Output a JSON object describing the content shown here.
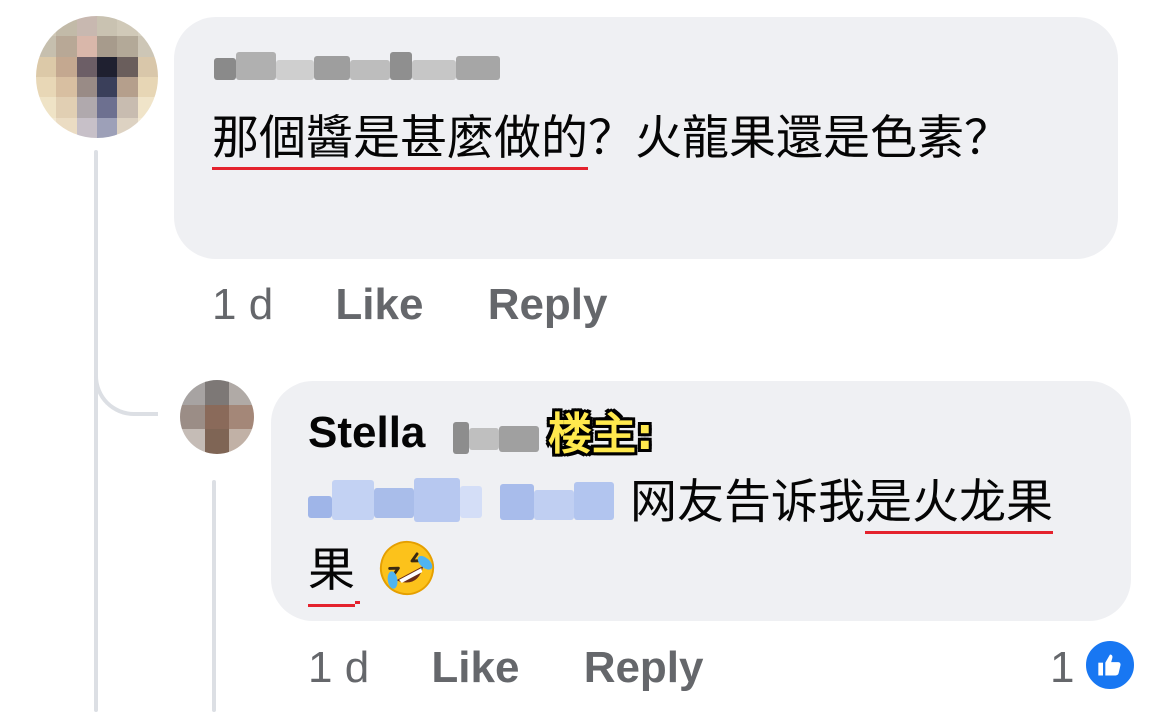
{
  "comments": [
    {
      "author_redacted": true,
      "text_part1": "那個醬是甚麼做的",
      "text_part2": "？火龍果還是色素？",
      "time": "1 d",
      "like_label": "Like",
      "reply_label": "Reply"
    },
    {
      "author_first": "Stella",
      "op_badge": "楼主:",
      "mention_redacted": true,
      "text_part1": "网友告诉我",
      "text_part2": "是火龙果",
      "emoji": "rolling-on-floor-laughing",
      "time": "1 d",
      "like_label": "Like",
      "reply_label": "Reply",
      "reaction_count": "1"
    }
  ],
  "colors": {
    "bubble": "#eff0f3",
    "underline": "#e4222d",
    "meta": "#65676b",
    "like_blue": "#1877f2",
    "badge_yellow": "#ffe94d"
  }
}
